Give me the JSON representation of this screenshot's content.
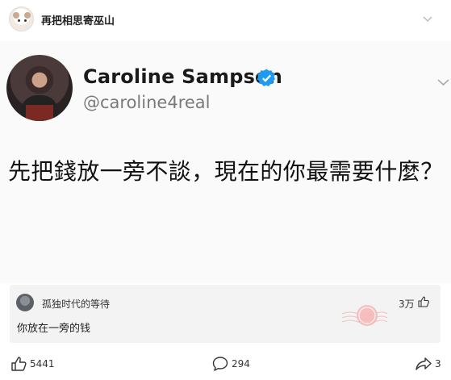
{
  "header": {
    "username": "再把相思寄巫山"
  },
  "tweet": {
    "name": "Caroline Sampson",
    "handle": "@caroline4real",
    "text": "先把錢放一旁不談，現在的你最需要什麼？"
  },
  "top_comment": {
    "username": "孤独时代的等待",
    "text": "你放在一旁的钱",
    "likes": "3万"
  },
  "actions": {
    "likes": "5441",
    "comments": "294",
    "shares": "3"
  },
  "colors": {
    "verified": "#1d9bf0",
    "stamp": "#e86a6a"
  }
}
